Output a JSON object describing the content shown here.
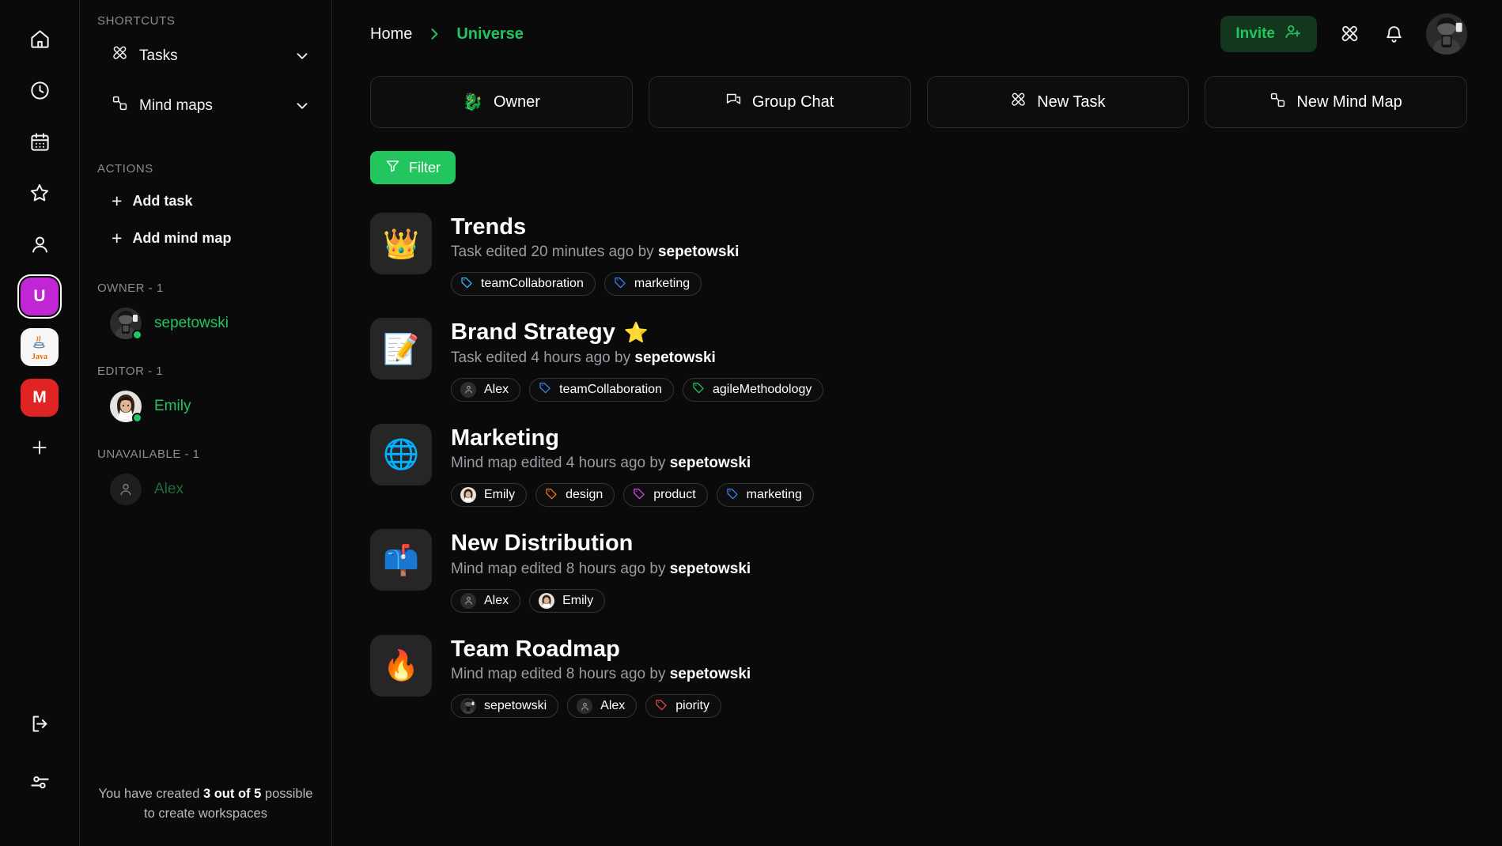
{
  "rail": {
    "nav_icons": [
      {
        "name": "home-icon",
        "label": "Home"
      },
      {
        "name": "clock-icon",
        "label": "Recent"
      },
      {
        "name": "calendar-icon",
        "label": "Calendar"
      },
      {
        "name": "star-icon",
        "label": "Starred"
      },
      {
        "name": "user-icon",
        "label": "Profile"
      }
    ],
    "workspaces": [
      {
        "letter": "U",
        "color": "#c026d3",
        "selected": true
      },
      {
        "letter": "Java",
        "color": "#f7f7f7",
        "selected": false
      },
      {
        "letter": "M",
        "color": "#e02424",
        "selected": false
      }
    ],
    "add_workspace_label": "+",
    "bottom_icons": [
      {
        "name": "logout-icon",
        "label": "Log out"
      },
      {
        "name": "settings-sliders-icon",
        "label": "Settings"
      }
    ]
  },
  "panel": {
    "shortcuts_title": "SHORTCUTS",
    "shortcuts": [
      {
        "label": "Tasks",
        "icon": "tasks-icon"
      },
      {
        "label": "Mind maps",
        "icon": "mindmap-icon"
      }
    ],
    "actions_title": "ACTIONS",
    "actions": [
      {
        "label": "Add task"
      },
      {
        "label": "Add mind map"
      }
    ],
    "member_groups": [
      {
        "title": "OWNER - 1",
        "members": [
          {
            "name": "sepetowski",
            "online": true,
            "avatar": "photo-sepetowski",
            "dim": false
          }
        ]
      },
      {
        "title": "EDITOR - 1",
        "members": [
          {
            "name": "Emily",
            "online": true,
            "avatar": "photo-emily",
            "dim": false
          }
        ]
      },
      {
        "title": "UNAVAILABLE - 1",
        "members": [
          {
            "name": "Alex",
            "online": false,
            "avatar": "placeholder-user",
            "dim": true
          }
        ]
      }
    ],
    "footer": {
      "prefix": "You have created ",
      "count": "3 out of 5",
      "suffix": " possible to create workspaces"
    }
  },
  "topbar": {
    "breadcrumb_home": "Home",
    "breadcrumb_current": "Universe",
    "invite_label": "Invite",
    "icons": [
      {
        "name": "tasks-icon"
      },
      {
        "name": "bell-icon"
      }
    ]
  },
  "quick_actions": [
    {
      "label": "Owner",
      "icon": "dragon-emoji",
      "emoji": "🐉"
    },
    {
      "label": "Group Chat",
      "icon": "chat-icon",
      "emoji": ""
    },
    {
      "label": "New Task",
      "icon": "tasks-icon",
      "emoji": ""
    },
    {
      "label": "New Mind Map",
      "icon": "mindmap-icon",
      "emoji": ""
    }
  ],
  "filter": {
    "label": "Filter",
    "icon": "funnel-icon",
    "color": "#22c55e"
  },
  "items": [
    {
      "title": "Trends",
      "starred": false,
      "emoji": "👑",
      "subtitle_prefix": "Task edited 20 minutes ago by ",
      "author": "sepetowski",
      "tags": [
        {
          "label": "teamCollaboration",
          "type": "tag",
          "color": "#38bdf8"
        },
        {
          "label": "marketing",
          "type": "tag",
          "color": "#3b82f6"
        }
      ]
    },
    {
      "title": "Brand Strategy",
      "starred": true,
      "star": "⭐",
      "emoji": "📝",
      "subtitle_prefix": "Task edited 4 hours ago by ",
      "author": "sepetowski",
      "tags": [
        {
          "label": "Alex",
          "type": "user-placeholder",
          "color": "#9a9a9a"
        },
        {
          "label": "teamCollaboration",
          "type": "tag",
          "color": "#3b82f6"
        },
        {
          "label": "agileMethodology",
          "type": "tag",
          "color": "#22c55e"
        }
      ]
    },
    {
      "title": "Marketing",
      "starred": false,
      "emoji": "🌐",
      "subtitle_prefix": "Mind map edited 4 hours ago by ",
      "author": "sepetowski",
      "tags": [
        {
          "label": "Emily",
          "type": "user-photo-emily",
          "color": ""
        },
        {
          "label": "design",
          "type": "tag",
          "color": "#f97316"
        },
        {
          "label": "product",
          "type": "tag",
          "color": "#d946ef"
        },
        {
          "label": "marketing",
          "type": "tag",
          "color": "#3b82f6"
        }
      ]
    },
    {
      "title": "New Distribution",
      "starred": false,
      "emoji": "📫",
      "subtitle_prefix": "Mind map edited 8 hours ago by ",
      "author": "sepetowski",
      "tags": [
        {
          "label": "Alex",
          "type": "user-placeholder",
          "color": "#9a9a9a"
        },
        {
          "label": "Emily",
          "type": "user-photo-emily",
          "color": ""
        }
      ]
    },
    {
      "title": "Team Roadmap",
      "starred": false,
      "emoji": "🔥",
      "subtitle_prefix": "Mind map edited 8 hours ago by ",
      "author": "sepetowski",
      "tags": [
        {
          "label": "sepetowski",
          "type": "user-photo-sepetowski",
          "color": ""
        },
        {
          "label": "Alex",
          "type": "user-placeholder",
          "color": "#9a9a9a"
        },
        {
          "label": "piority",
          "type": "tag",
          "color": "#ef4444"
        }
      ]
    }
  ]
}
